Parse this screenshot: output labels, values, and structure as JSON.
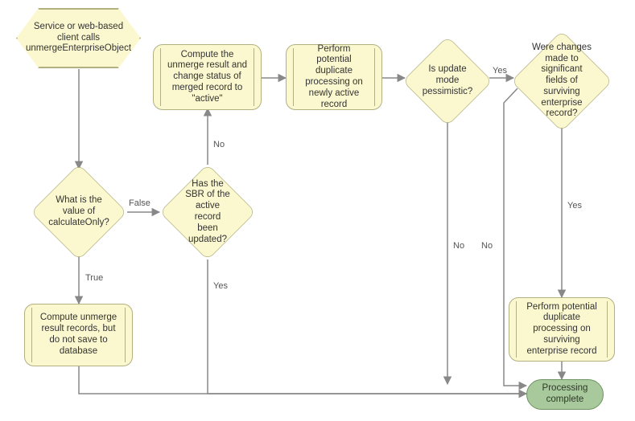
{
  "nodes": {
    "start": "Service or web-based client calls unmergeEnterpriseObject",
    "d_calcOnly": "What is the value of calculateOnly?",
    "p_computeNoSave": "Compute unmerge result records, but do not save to database",
    "d_sbrUpdated": "Has the SBR of the active record been updated?",
    "p_computeAndActive": "Compute the unmerge result and change status of merged record to \"active\"",
    "p_pdpNewActive": "Perform potential duplicate processing on newly active record",
    "d_updatePess": "Is update mode pessimistic?",
    "d_sigChanges": "Were changes made to significant fields of surviving enterprise record?",
    "p_pdpSurviving": "Perform potential duplicate processing on surviving enterprise record",
    "end": "Processing complete"
  },
  "labels": {
    "true": "True",
    "false": "False",
    "yes": "Yes",
    "no": "No"
  }
}
